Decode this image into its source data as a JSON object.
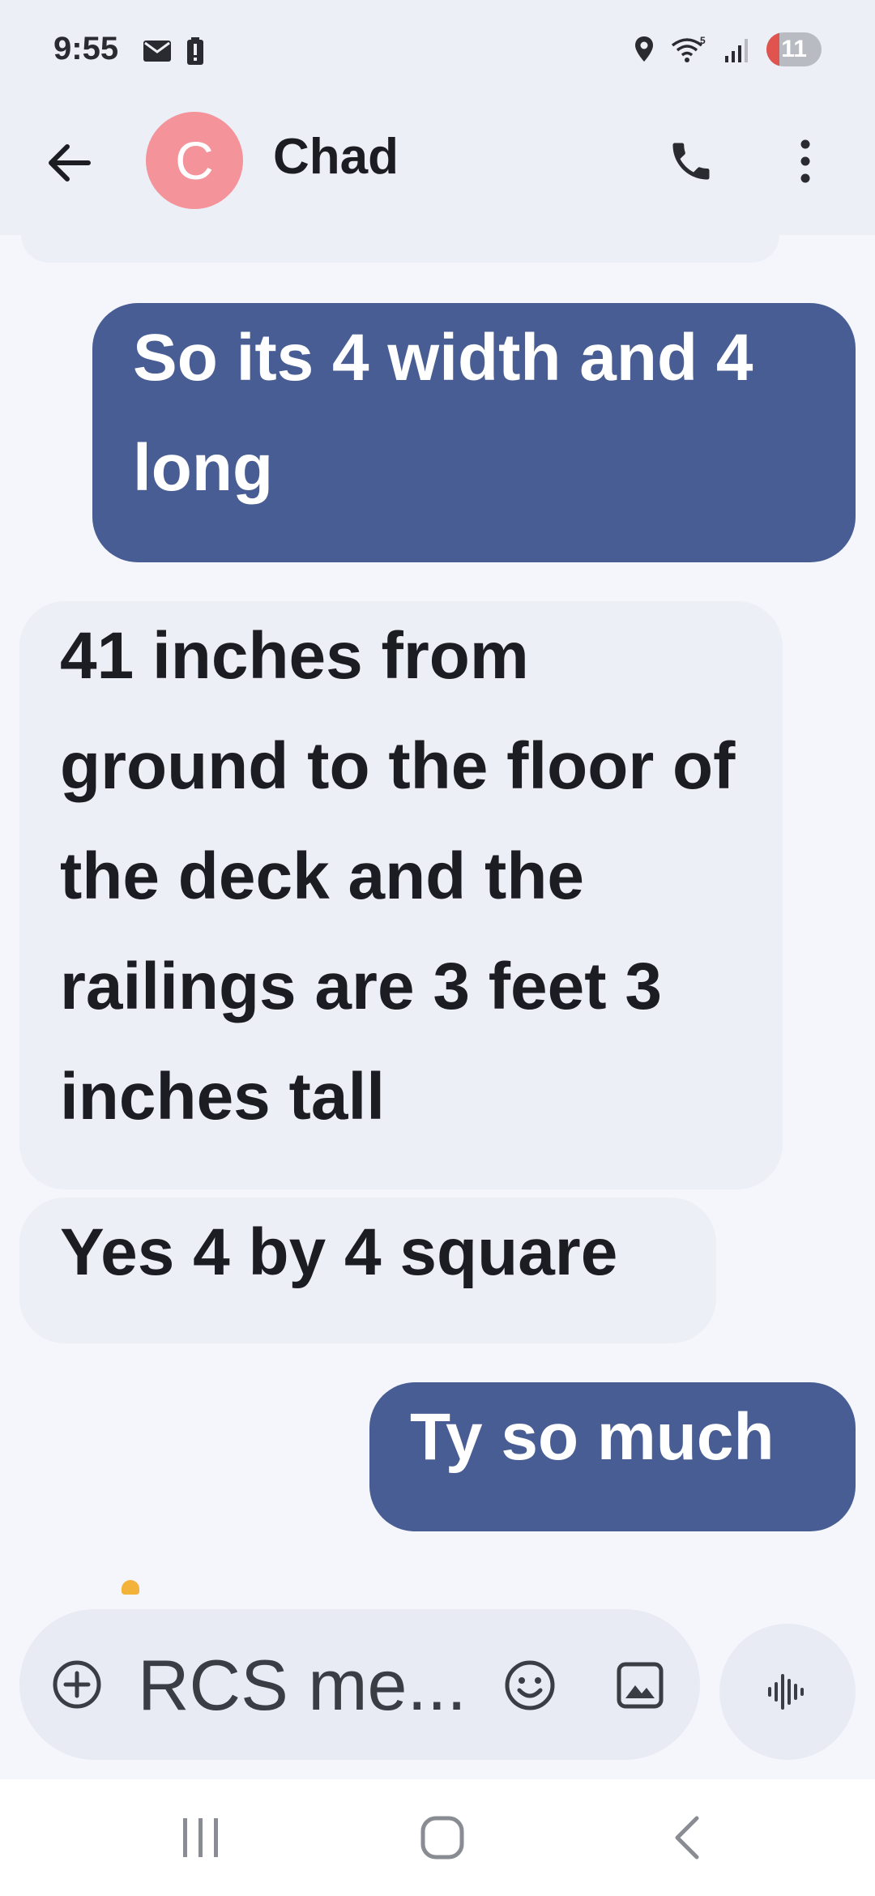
{
  "status_bar": {
    "time": "9:55",
    "battery_level": "11",
    "icons_left": [
      "mail-icon",
      "battery-alert-icon"
    ],
    "icons_right": [
      "location-icon",
      "wifi-5-icon",
      "signal-icon"
    ]
  },
  "header": {
    "avatar_initial": "C",
    "avatar_color": "#f4939a",
    "contact_name": "Chad"
  },
  "messages": [
    {
      "direction": "outgoing",
      "text": "So its 4 width and 4 long"
    },
    {
      "direction": "incoming",
      "text": "41 inches from ground to the floor of the deck and the railings are 3 feet 3 inches tall"
    },
    {
      "direction": "incoming",
      "text": "Yes 4 by 4 square"
    },
    {
      "direction": "outgoing",
      "text": "Ty so much"
    }
  ],
  "composer": {
    "placeholder": "RCS me..."
  },
  "colors": {
    "outgoing_bubble": "#485d93",
    "incoming_bubble": "#eceff6",
    "background": "#f5f6fc"
  }
}
